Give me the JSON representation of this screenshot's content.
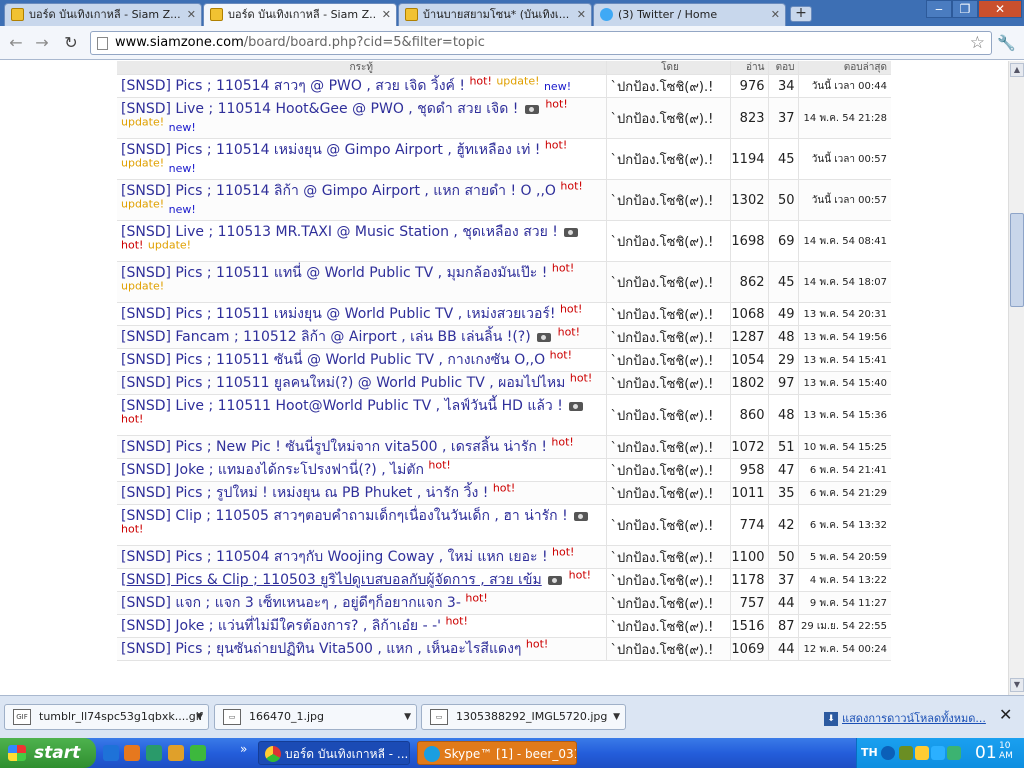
{
  "browser": {
    "tabs": [
      {
        "title": "บอร์ด บันเทิงเกาหลี - Siam Z...",
        "icon": "siamzone-favicon-icon",
        "active": false
      },
      {
        "title": "บอร์ด บันเทิงเกาหลี - Siam Z...",
        "icon": "siamzone-favicon-icon",
        "active": true
      },
      {
        "title": "บ้านบายสยามโซน* (บันเทิงเ...",
        "icon": "siamzone-favicon-icon",
        "active": false
      },
      {
        "title": "(3) Twitter / Home",
        "icon": "twitter-favicon-icon",
        "active": false
      }
    ],
    "address": {
      "host": "www.siamzone.com",
      "path": "/board/board.php?cid=5&filter=topic"
    },
    "window_controls": {
      "minimize": "‒",
      "restore": "❐",
      "close": "✕"
    }
  },
  "board": {
    "headers": {
      "title": "กระทู้",
      "author": "โดย",
      "views": "อ่าน",
      "replies": "ตอบ",
      "last": "ตอบล่าสุด"
    },
    "rows": [
      {
        "title": "[SNSD] Pics ; 110514 สาวๆ @ PWO , สวย เจิด วิ้งค์ !",
        "cam": false,
        "hot": true,
        "update": true,
        "new": true,
        "author": "`ปกป้อง.โซชิ(๙).!",
        "views": "976",
        "replies": "34",
        "last": "วันนี้ เวลา 00:44"
      },
      {
        "title": "[SNSD] Live ; 110514 Hoot&Gee @ PWO , ชุดดำ สวย เจิด !",
        "cam": true,
        "hot": true,
        "update": true,
        "new": true,
        "author": "`ปกป้อง.โซชิ(๙).!",
        "views": "823",
        "replies": "37",
        "last": "14 พ.ค. 54 21:28"
      },
      {
        "title": "[SNSD] Pics ; 110514 เหม่งยุน @ Gimpo Airport , ฮู้ทเหลือง เท่ !",
        "cam": false,
        "hot": true,
        "update": true,
        "new": true,
        "author": "`ปกป้อง.โซชิ(๙).!",
        "views": "1194",
        "replies": "45",
        "last": "วันนี้ เวลา 00:57"
      },
      {
        "title": "[SNSD] Pics ; 110514 ลิก้า @ Gimpo Airport , แหก สายดำ ! O ,,O",
        "cam": false,
        "hot": true,
        "update": true,
        "new": true,
        "author": "`ปกป้อง.โซชิ(๙).!",
        "views": "1302",
        "replies": "50",
        "last": "วันนี้ เวลา 00:57"
      },
      {
        "title": "[SNSD] Live ; 110513 MR.TAXI @ Music Station , ชุดเหลือง สวย !",
        "cam": true,
        "hot": true,
        "update": true,
        "new": false,
        "author": "`ปกป้อง.โซชิ(๙).!",
        "views": "1698",
        "replies": "69",
        "last": "14 พ.ค. 54 08:41"
      },
      {
        "title": "[SNSD] Pics ; 110511 แทนี่ @ World Public TV , มุมกล้องมันเป๊ะ !",
        "cam": false,
        "hot": true,
        "update": true,
        "new": false,
        "author": "`ปกป้อง.โซชิ(๙).!",
        "views": "862",
        "replies": "45",
        "last": "14 พ.ค. 54 18:07"
      },
      {
        "title": "[SNSD] Pics ; 110511 เหม่งยุน @ World Public TV , เหม่งสวยเวอร์!",
        "cam": false,
        "hot": true,
        "update": false,
        "new": false,
        "author": "`ปกป้อง.โซชิ(๙).!",
        "views": "1068",
        "replies": "49",
        "last": "13 พ.ค. 54 20:31"
      },
      {
        "title": "[SNSD] Fancam ; 110512 ลิก้า @ Airport , เล่น BB เล่นลิ้น !(?)",
        "cam": true,
        "hot": true,
        "update": false,
        "new": false,
        "author": "`ปกป้อง.โซชิ(๙).!",
        "views": "1287",
        "replies": "48",
        "last": "13 พ.ค. 54 19:56"
      },
      {
        "title": "[SNSD] Pics ; 110511 ซันนี่ @ World Public TV , กางเกงซัน O,,O",
        "cam": false,
        "hot": true,
        "update": false,
        "new": false,
        "author": "`ปกป้อง.โซชิ(๙).!",
        "views": "1054",
        "replies": "29",
        "last": "13 พ.ค. 54 15:41"
      },
      {
        "title": "[SNSD] Pics ; 110511 ยูลคนใหม่(?) @ World Public TV , ผอมไปไหม",
        "cam": false,
        "hot": true,
        "update": false,
        "new": false,
        "author": "`ปกป้อง.โซชิ(๙).!",
        "views": "1802",
        "replies": "97",
        "last": "13 พ.ค. 54 15:40"
      },
      {
        "title": "[SNSD] Live ; 110511 Hoot@World Public TV , ไลฟ์วันนี้ HD แล้ว !",
        "cam": true,
        "hot": true,
        "update": false,
        "new": false,
        "author": "`ปกป้อง.โซชิ(๙).!",
        "views": "860",
        "replies": "48",
        "last": "13 พ.ค. 54 15:36"
      },
      {
        "title": "[SNSD] Pics ; New Pic ! ซันนี่รูปใหม่จาก vita500 , เดรสลิ้น น่ารัก !",
        "cam": false,
        "hot": true,
        "update": false,
        "new": false,
        "author": "`ปกป้อง.โซชิ(๙).!",
        "views": "1072",
        "replies": "51",
        "last": "10 พ.ค. 54 15:25"
      },
      {
        "title": "[SNSD] Joke ; แทมองได้กระโปรงฟานี่(?) , ไม่ตัก",
        "cam": false,
        "hot": true,
        "update": false,
        "new": false,
        "author": "`ปกป้อง.โซชิ(๙).!",
        "views": "958",
        "replies": "47",
        "last": "6 พ.ค. 54 21:41"
      },
      {
        "title": "[SNSD] Pics ; รูปใหม่ ! เหม่งยุน ณ PB Phuket , น่ารัก วิ้ง !",
        "cam": false,
        "hot": true,
        "update": false,
        "new": false,
        "author": "`ปกป้อง.โซชิ(๙).!",
        "views": "1011",
        "replies": "35",
        "last": "6 พ.ค. 54 21:29"
      },
      {
        "title": "[SNSD] Clip ; 110505 สาวๆตอบคำถามเด็กๆเนื่องในวันเด็ก , ฮา น่ารัก !",
        "cam": true,
        "hot": true,
        "update": false,
        "new": false,
        "author": "`ปกป้อง.โซชิ(๙).!",
        "views": "774",
        "replies": "42",
        "last": "6 พ.ค. 54 13:32"
      },
      {
        "title": "[SNSD] Pics ; 110504 สาวๆกับ Woojing Coway , ใหม่ แหก เยอะ !",
        "cam": false,
        "hot": true,
        "update": false,
        "new": false,
        "author": "`ปกป้อง.โซชิ(๙).!",
        "views": "1100",
        "replies": "50",
        "last": "5 พ.ค. 54 20:59"
      },
      {
        "title": "[SNSD] Pics & Clip ; 110503 ยูริไปดูเบสบอลกับผู้จัดการ , สวย เข้ม",
        "cam": true,
        "hot": true,
        "update": false,
        "new": false,
        "underline": true,
        "author": "`ปกป้อง.โซชิ(๙).!",
        "views": "1178",
        "replies": "37",
        "last": "4 พ.ค. 54 13:22"
      },
      {
        "title": "[SNSD] แจก ; แจก 3 เซ็ทเหนอะๆ , อยู่ดีๆก็อยากแจก 3-",
        "cam": false,
        "hot": true,
        "update": false,
        "new": false,
        "author": "`ปกป้อง.โซชิ(๙).!",
        "views": "757",
        "replies": "44",
        "last": "9 พ.ค. 54 11:27"
      },
      {
        "title": "[SNSD] Joke ; แว่นที่ไม่มีใครต้องการ? , ลิก้าเอ๋ย - -'",
        "cam": false,
        "hot": true,
        "update": false,
        "new": false,
        "author": "`ปกป้อง.โซชิ(๙).!",
        "views": "1516",
        "replies": "87",
        "last": "29 เม.ย. 54 22:55"
      },
      {
        "title": "[SNSD] Pics ; ยุนซันถ่ายปฏิทิน Vita500 , แหก , เห็นอะไรสีแดงๆ",
        "cam": false,
        "hot": true,
        "update": false,
        "new": false,
        "author": "`ปกป้อง.โซชิ(๙).!",
        "views": "1069",
        "replies": "44",
        "last": "12 พ.ค. 54 00:24"
      }
    ],
    "tag_labels": {
      "hot": "hot!",
      "update": "update!",
      "new": "new!"
    }
  },
  "downloads": {
    "items": [
      {
        "name": "tumblr_ll74spc53g1qbxk....gif",
        "icon": "gif-file-icon",
        "icon_text": "GIF"
      },
      {
        "name": "166470_1.jpg",
        "icon": "image-file-icon",
        "icon_text": ""
      },
      {
        "name": "1305388292_IMGL5720.jpg",
        "icon": "image-file-icon",
        "icon_text": ""
      }
    ],
    "show_all": "แสดงการดาวน์โหลดทั้งหมด..."
  },
  "taskbar": {
    "start_label": "start",
    "windows": [
      {
        "label": "บอร์ด บันเทิงเกาหลี - ...",
        "icon": "chrome-icon",
        "active": true
      },
      {
        "label": "Skype™ [1] - beer_031",
        "icon": "skype-icon",
        "active": false
      }
    ],
    "more_indicator": "»",
    "language": "TH",
    "clock": "01",
    "clock_minutes": "10",
    "clock_ampm": "AM"
  },
  "colors": {
    "link": "#2f2f9a",
    "hot": "#cc0000",
    "update": "#e0a000",
    "new": "#1a1acc",
    "taskbar": "#245edb",
    "start": "#2f8f2f"
  }
}
